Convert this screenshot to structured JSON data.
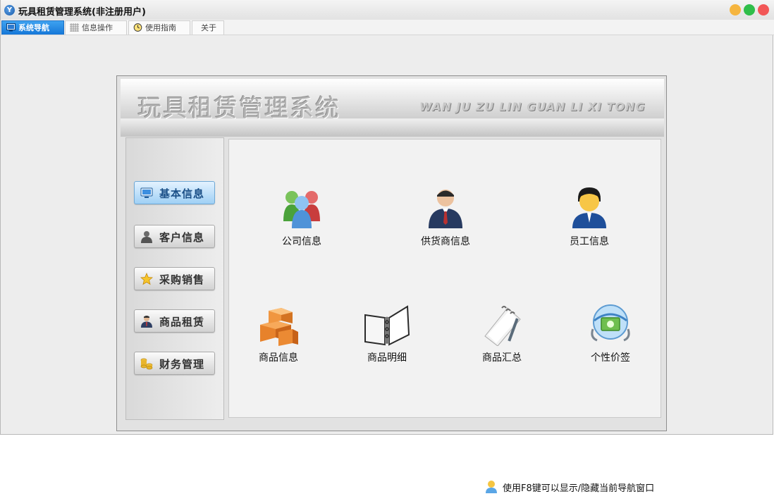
{
  "window": {
    "title": "玩具租赁管理系统(非注册用户)"
  },
  "tabs": [
    {
      "label": "系统导航"
    },
    {
      "label": "信息操作"
    },
    {
      "label": "使用指南"
    },
    {
      "label": "关于"
    }
  ],
  "banner": {
    "title": "玩具租赁管理系统",
    "subtitle": "WAN JU ZU LIN GUAN LI XI TONG"
  },
  "sidebar": {
    "items": [
      {
        "label": "基本信息",
        "icon": "monitor-icon"
      },
      {
        "label": "客户信息",
        "icon": "person-icon"
      },
      {
        "label": "采购销售",
        "icon": "star-icon"
      },
      {
        "label": "商品租赁",
        "icon": "businessman-icon"
      },
      {
        "label": "财务管理",
        "icon": "coins-icon"
      }
    ]
  },
  "content": {
    "items": [
      {
        "label": "公司信息",
        "icon": "people-group-icon"
      },
      {
        "label": "供货商信息",
        "icon": "businessman-icon"
      },
      {
        "label": "员工信息",
        "icon": "employee-icon"
      },
      {
        "label": "商品信息",
        "icon": "boxes-icon"
      },
      {
        "label": "商品明细",
        "icon": "notebook-icon"
      },
      {
        "label": "商品汇总",
        "icon": "notepad-icon"
      },
      {
        "label": "个性价签",
        "icon": "price-tag-icon"
      }
    ],
    "hint": "使用F8键可以显示/隐藏当前导航窗口"
  },
  "colors": {
    "tab_active": "#1577d8",
    "close": "#f25757",
    "max": "#2fbe4a",
    "min": "#f5b53f"
  }
}
